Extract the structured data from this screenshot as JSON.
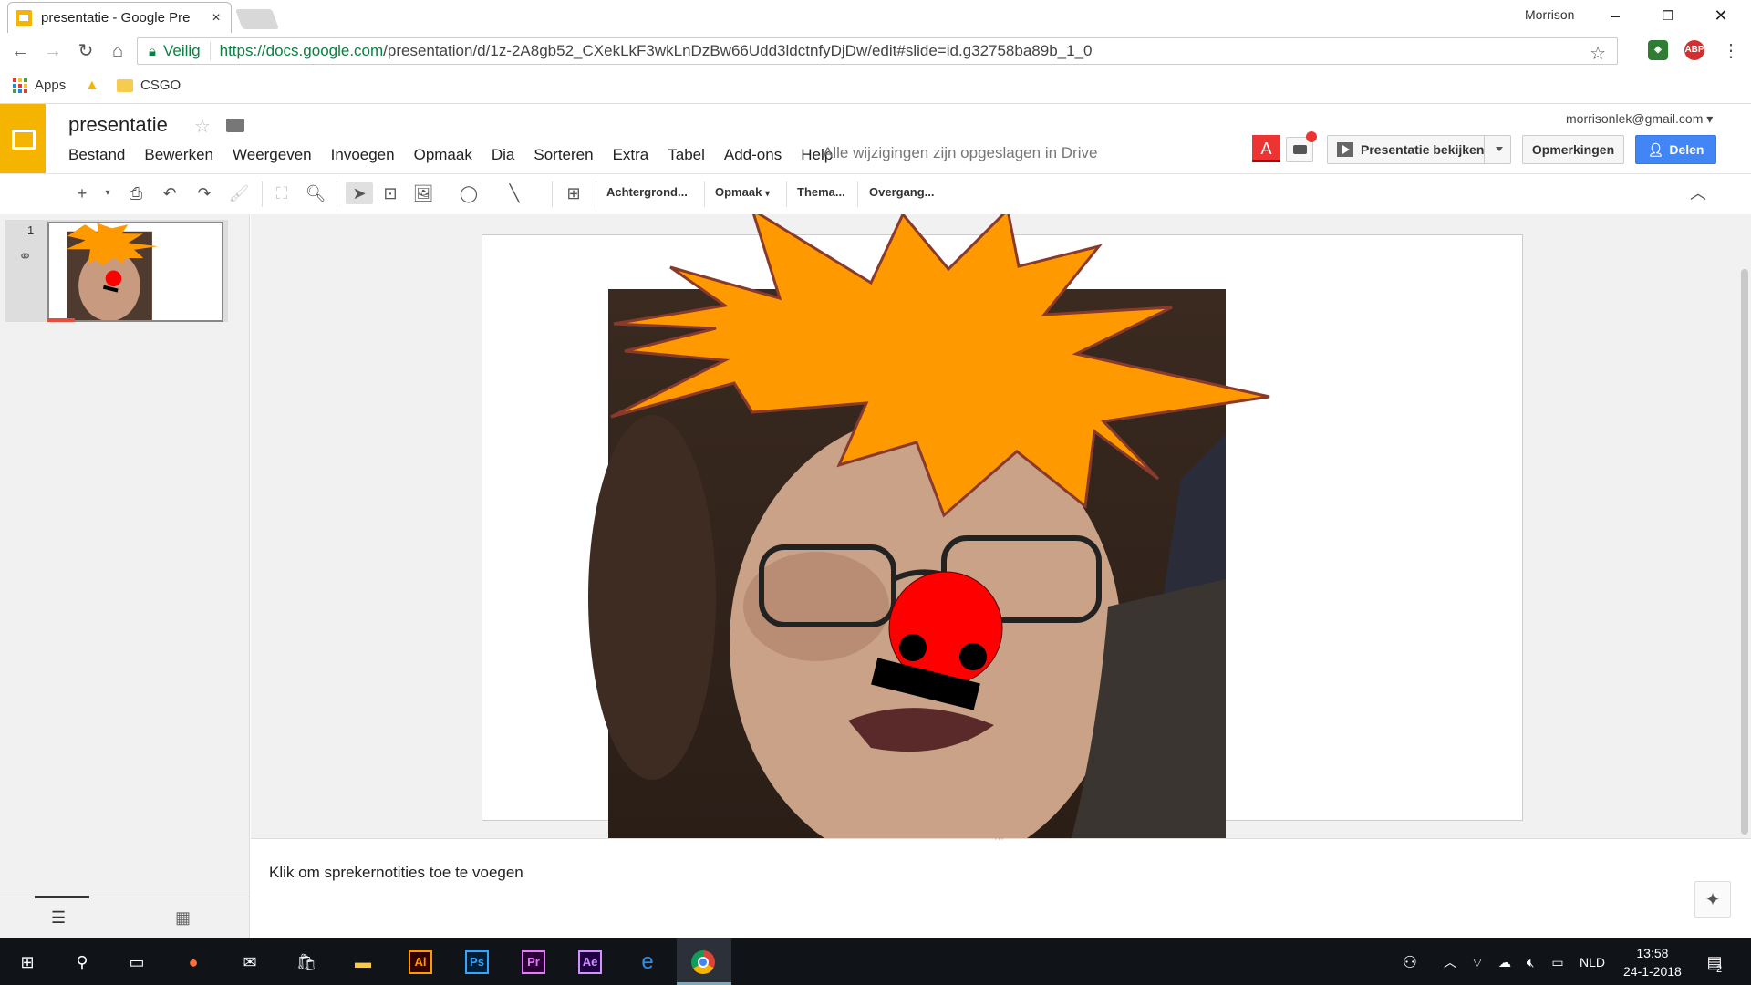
{
  "browser": {
    "tab_title": "presentatie - Google Pre",
    "tab_close": "×",
    "window_user": "Morrison",
    "secure_label": "Veilig",
    "url_host": "https://docs.google.com",
    "url_path": "/presentation/d/1z-2A8gb52_CXekLkF3wkLnDzBw66Udd3ldctnfyDjDw/edit#slide=id.g32758ba89b_1_0",
    "ext_abp": "ABP"
  },
  "bookmarks": [
    {
      "label": "Apps",
      "icon": "apps-grid-icon"
    },
    {
      "label": "",
      "icon": "drive-icon"
    },
    {
      "label": "CSGO",
      "icon": "folder-icon"
    }
  ],
  "doc": {
    "title": "presentatie",
    "account": "morrisonlek@gmail.com",
    "saved_status": "Alle wijzigingen zijn opgeslagen in Drive",
    "menu": [
      "Bestand",
      "Bewerken",
      "Weergeven",
      "Invoegen",
      "Opmaak",
      "Dia",
      "Sorteren",
      "Extra",
      "Tabel",
      "Add-ons",
      "Help"
    ],
    "present_label": "Presentatie bekijken",
    "comments_label": "Opmerkingen",
    "share_label": "Delen",
    "a_badge": "A"
  },
  "toolbar": {
    "background": "Achtergrond...",
    "format": "Opmaak",
    "theme": "Thema...",
    "transition": "Overgang..."
  },
  "filmstrip": {
    "slide_number": "1"
  },
  "notes": {
    "placeholder": "Klik om sprekernotities toe te voegen"
  },
  "taskbar": {
    "apps": [
      "Ai",
      "Ps",
      "Pr",
      "Ae"
    ],
    "lang": "NLD",
    "time": "13:58",
    "date": "24-1-2018",
    "notif_count": "2"
  },
  "colors": {
    "brand": "#f4b400",
    "share": "#4285f4",
    "star_fill": "#ff9900",
    "nose": "#ff0000"
  }
}
